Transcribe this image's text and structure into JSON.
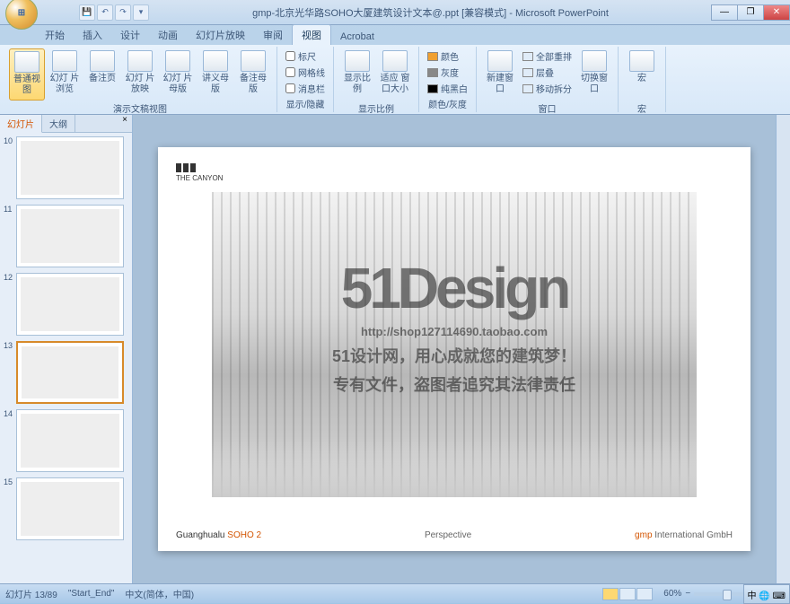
{
  "window": {
    "title": "gmp-北京光华路SOHO大厦建筑设计文本@.ppt [兼容模式] - Microsoft PowerPoint",
    "min": "—",
    "max": "❐",
    "close": "✕"
  },
  "qat": [
    "save-icon",
    "undo-icon",
    "redo-icon",
    "print-icon",
    "dropdown-icon"
  ],
  "tabs": {
    "items": [
      "开始",
      "插入",
      "设计",
      "动画",
      "幻灯片放映",
      "审阅",
      "视图",
      "Acrobat"
    ],
    "active_index": 6
  },
  "ribbon": {
    "groups": [
      {
        "label": "演示文稿视图",
        "large": [
          {
            "label": "普通视图",
            "active": true
          },
          {
            "label": "幻灯\n片浏览"
          },
          {
            "label": "备注页"
          },
          {
            "label": "幻灯\n片放映"
          },
          {
            "label": "幻灯\n片母版"
          },
          {
            "label": "讲义母版"
          },
          {
            "label": "备注母版"
          }
        ]
      },
      {
        "label": "显示/隐藏",
        "checks": [
          {
            "label": "标尺",
            "checked": false
          },
          {
            "label": "网格线",
            "checked": false
          },
          {
            "label": "消息栏",
            "checked": false
          }
        ]
      },
      {
        "label": "显示比例",
        "large": [
          {
            "label": "显示比例"
          },
          {
            "label": "适应\n窗口大小"
          }
        ]
      },
      {
        "label": "颜色/灰度",
        "colors": [
          {
            "label": "颜色",
            "sw": "#f0a030"
          },
          {
            "label": "灰度",
            "sw": "#888888"
          },
          {
            "label": "纯黑白",
            "sw": "#000000"
          }
        ]
      },
      {
        "label": "窗口",
        "large": [
          {
            "label": "新建窗口"
          }
        ],
        "small": [
          "全部重排",
          "层叠",
          "移动拆分"
        ],
        "large2": [
          {
            "label": "切换窗\n口"
          }
        ]
      },
      {
        "label": "宏",
        "large": [
          {
            "label": "宏"
          }
        ]
      }
    ]
  },
  "sidepanel": {
    "tab1": "幻灯片",
    "tab2": "大纲",
    "close": "×",
    "thumbs": [
      {
        "num": "10"
      },
      {
        "num": "11"
      },
      {
        "num": "12"
      },
      {
        "num": "13",
        "selected": true
      },
      {
        "num": "14"
      },
      {
        "num": "15"
      }
    ]
  },
  "slide": {
    "logo_text": "THE CANYON",
    "wm_big": "51Design",
    "wm_url": "http://shop127114690.taobao.com",
    "wm_cn1": "51设计网，用心成就您的建筑梦！",
    "wm_cn2": "专有文件，盗图者追究其法律责任",
    "footer_left_a": "Guanghualu ",
    "footer_left_b": "SOHO 2",
    "footer_center": "Perspective",
    "footer_right_a": "gmp",
    "footer_right_b": " International GmbH"
  },
  "status": {
    "slide_counter": "幻灯片 13/89",
    "section": "\"Start_End\"",
    "lang": "中文(简体，中国)",
    "zoom_pct": "60%",
    "zoom_minus": "−",
    "zoom_plus": "+",
    "fit": "⛶"
  },
  "taskbar": {
    "ime": "中 🌐 ⌨"
  }
}
